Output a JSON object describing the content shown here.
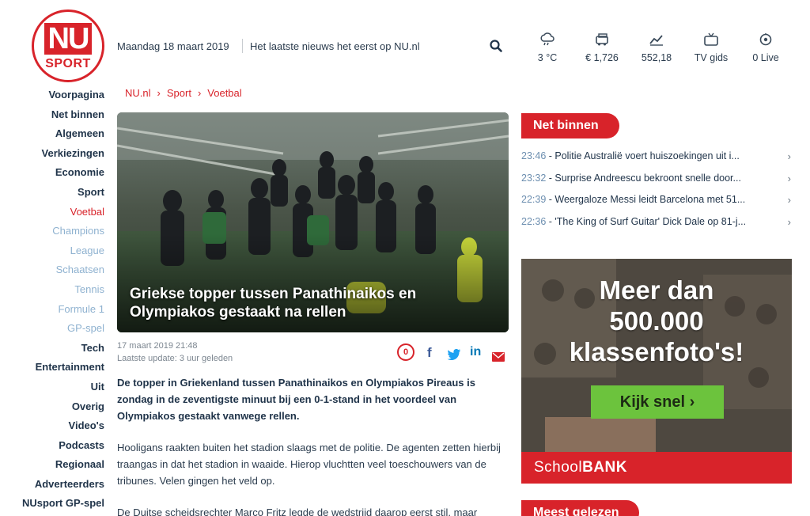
{
  "logo": {
    "top": "NU",
    "bottom": "SPORT"
  },
  "header": {
    "date": "Maandag 18 maart 2019",
    "tagline": "Het laatste nieuws het eerst op NU.nl"
  },
  "widgets": [
    {
      "icon": "weather-icon",
      "value": "3 °C"
    },
    {
      "icon": "aex-icon",
      "value": "€ 1,726"
    },
    {
      "icon": "index-chart-icon",
      "value": "552,18"
    },
    {
      "icon": "tv-icon",
      "value": "TV gids"
    },
    {
      "icon": "live-icon",
      "value": "0 Live"
    }
  ],
  "nav": {
    "items": [
      {
        "label": "Voorpagina",
        "state": "normal"
      },
      {
        "label": "Net binnen",
        "state": "normal"
      },
      {
        "label": "Algemeen",
        "state": "normal"
      },
      {
        "label": "Verkiezingen",
        "state": "normal"
      },
      {
        "label": "Economie",
        "state": "normal"
      },
      {
        "label": "Sport",
        "state": "normal"
      },
      {
        "label": "Voetbal",
        "state": "active"
      },
      {
        "label": "Champions",
        "state": "sub"
      },
      {
        "label": "League",
        "state": "sub"
      },
      {
        "label": "Schaatsen",
        "state": "sub"
      },
      {
        "label": "Tennis",
        "state": "sub"
      },
      {
        "label": "Formule 1",
        "state": "sub"
      },
      {
        "label": "GP-spel",
        "state": "sub"
      },
      {
        "label": "Tech",
        "state": "normal"
      },
      {
        "label": "Entertainment",
        "state": "normal"
      },
      {
        "label": "Uit",
        "state": "normal"
      },
      {
        "label": "Overig",
        "state": "normal"
      },
      {
        "label": "Video's",
        "state": "normal"
      },
      {
        "label": "Podcasts",
        "state": "normal"
      },
      {
        "label": "Regionaal",
        "state": "normal"
      },
      {
        "label": "Adverteerders",
        "state": "normal"
      },
      {
        "label": "NUsport GP-spel",
        "state": "normal"
      }
    ]
  },
  "breadcrumb": {
    "items": [
      "NU.nl",
      "Sport",
      "Voetbal"
    ],
    "separator": "›"
  },
  "article": {
    "title": "Griekse topper tussen Panathinaikos en Olympiakos gestaakt na rellen",
    "published": "17 maart 2019 21:48",
    "updated": "Laatste update: 3 uur geleden",
    "comment_count": "0",
    "lead": "De topper in Griekenland tussen Panathinaikos en Olympiakos Pireaus is zondag in de zeventigste minuut bij een 0-1-stand in het voordeel van Olympiakos gestaakt vanwege rellen.",
    "paragraphs": [
      "Hooligans raakten buiten het stadion slaags met de politie. De agenten zetten hierbij traangas in dat het stadion in waaide. Hierop vluchtten veel toeschouwers van de tribunes. Velen gingen het veld op.",
      "De Duitse scheidsrechter Marco Fritz legde de wedstrijd daarop eerst stil, maar"
    ]
  },
  "right": {
    "net_binnen_label": "Net binnen",
    "net_binnen": [
      {
        "time": "23:46",
        "text": "Politie Australië voert huiszoekingen uit i..."
      },
      {
        "time": "23:32",
        "text": "Surprise Andreescu bekroont snelle door..."
      },
      {
        "time": "22:39",
        "text": "Weergaloze Messi leidt Barcelona met 51..."
      },
      {
        "time": "22:36",
        "text": "'The King of Surf Guitar' Dick Dale op 81-j..."
      }
    ],
    "ad": {
      "line1": "Meer dan",
      "line2": "500.000",
      "line3": "klassenfoto's!",
      "button": "Kijk snel ›",
      "brand_a": "School",
      "brand_b": "BANK"
    },
    "meest_gelezen_label": "Meest gelezen"
  },
  "colors": {
    "brand_red": "#d8232a",
    "nav_dark": "#1f3349",
    "nav_sub": "#8fb2d0",
    "ad_green": "#6cc33d"
  }
}
